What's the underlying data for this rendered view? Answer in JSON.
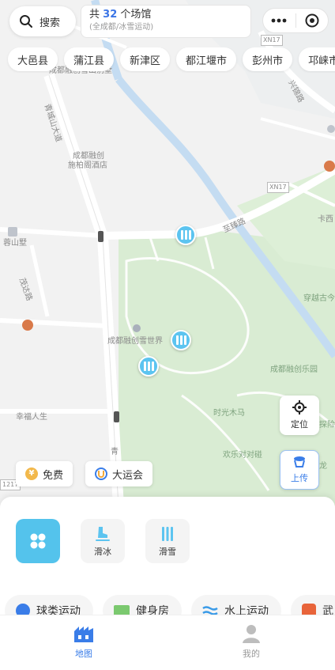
{
  "header": {
    "search_label": "搜索",
    "venue_prefix": "共",
    "venue_count": "32",
    "venue_suffix": "个场馆",
    "venue_scope": "(全成都/冰雪运动)"
  },
  "districts": [
    "大邑县",
    "蒲江县",
    "新津区",
    "都江堰市",
    "彭州市",
    "邛崃市"
  ],
  "map_labels": {
    "hotel_line1": "成都融创",
    "hotel_line2": "施柏阁酒店",
    "top_poi": "成都融创雪山别墅",
    "road_qingcheng": "青城山大道",
    "road_zhizhen": "至臻路",
    "road_maoda": "茂达路",
    "villa": "蓉山墅",
    "snow_world": "成都融创雪世界",
    "happy_park": "成都融创乐园",
    "chuanyue": "穿越古今",
    "merry_go": "时光木马",
    "happy_bump": "欢乐对对碰",
    "xingfu": "幸福人生",
    "road_qingcheng_short": "青",
    "road_xingjin": "兴锦路",
    "xn17": "XN17",
    "xn17b": "XN17",
    "east_label": "卡西",
    "tanxian": "探险",
    "dragon": "龙",
    "road_num": "1217"
  },
  "controls": {
    "locate_label": "定位",
    "upload_label": "上传",
    "free_label": "免费",
    "games_label": "大运会"
  },
  "categories": {
    "skate_label": "滑冰",
    "ski_label": "滑雪"
  },
  "sports": [
    "球类运动",
    "健身房",
    "水上运动",
    "武"
  ],
  "tabs": {
    "map_label": "地图",
    "mine_label": "我的"
  },
  "colors": {
    "accent": "#3a7de8",
    "marker": "#5cc4f0",
    "park_green": "#d9ecd3"
  }
}
